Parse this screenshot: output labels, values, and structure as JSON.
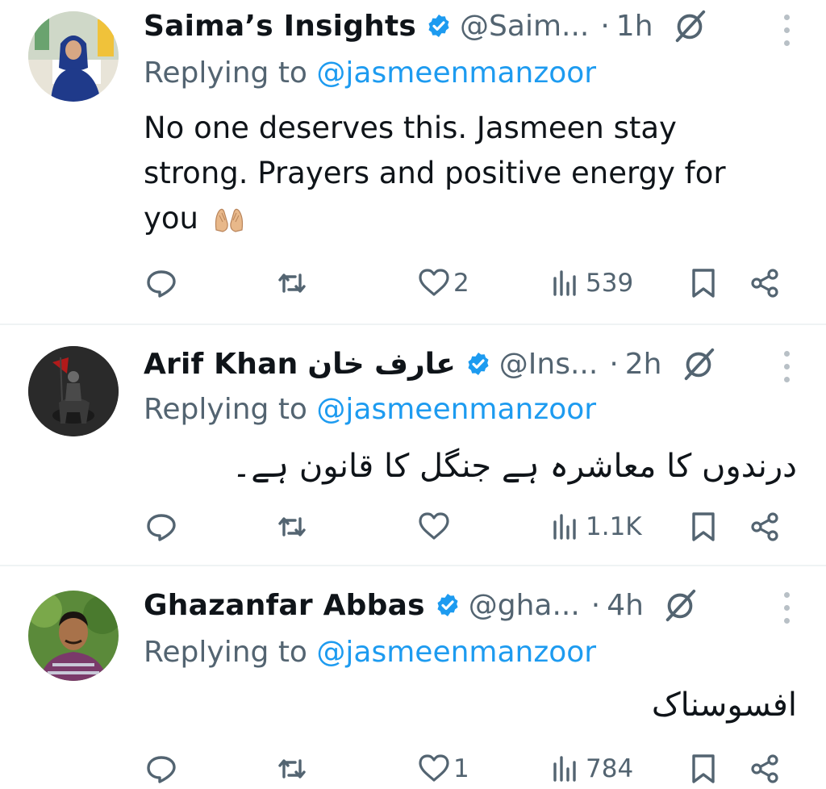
{
  "tweets": [
    {
      "name": "Saima’s Insights",
      "name_urdu": "",
      "handle": "@Saim...",
      "dot": "·",
      "time": "1h",
      "replying_prefix": "Replying to ",
      "replying_handle": "@jasmeenmanzoor",
      "text": "No one deserves this. Jasmeen stay strong. Prayers and positive energy for you",
      "text_emoji": "🤲🏼",
      "rtl": false,
      "metrics": {
        "replies": "",
        "reposts": "",
        "likes": "2",
        "views": "539"
      }
    },
    {
      "name": "Arif Khan",
      "name_urdu": "عارف خان",
      "handle": "@Ins...",
      "dot": "·",
      "time": "2h",
      "replying_prefix": "Replying to ",
      "replying_handle": "@jasmeenmanzoor",
      "text": "درندوں کا معاشرہ ہے جنگل کا قانون ہے۔",
      "rtl": true,
      "metrics": {
        "replies": "",
        "reposts": "",
        "likes": "",
        "views": "1.1K"
      }
    },
    {
      "name": "Ghazanfar Abbas",
      "name_urdu": "",
      "handle": "@gha...",
      "dot": "·",
      "time": "4h",
      "replying_prefix": "Replying to ",
      "replying_handle": "@jasmeenmanzoor",
      "text": "افسوسناک",
      "rtl": true,
      "metrics": {
        "replies": "",
        "reposts": "",
        "likes": "1",
        "views": "784"
      }
    }
  ],
  "icons": {
    "verified": "verified-badge-icon",
    "grok": "grok-icon",
    "more": "more-vertical-icon",
    "reply": "reply-icon",
    "repost": "repost-icon",
    "like": "heart-icon",
    "views": "views-icon",
    "bookmark": "bookmark-icon",
    "share": "share-icon"
  },
  "colors": {
    "accent": "#1d9bf0",
    "muted": "#536471",
    "text": "#0f1419",
    "divider": "#eff3f4"
  }
}
